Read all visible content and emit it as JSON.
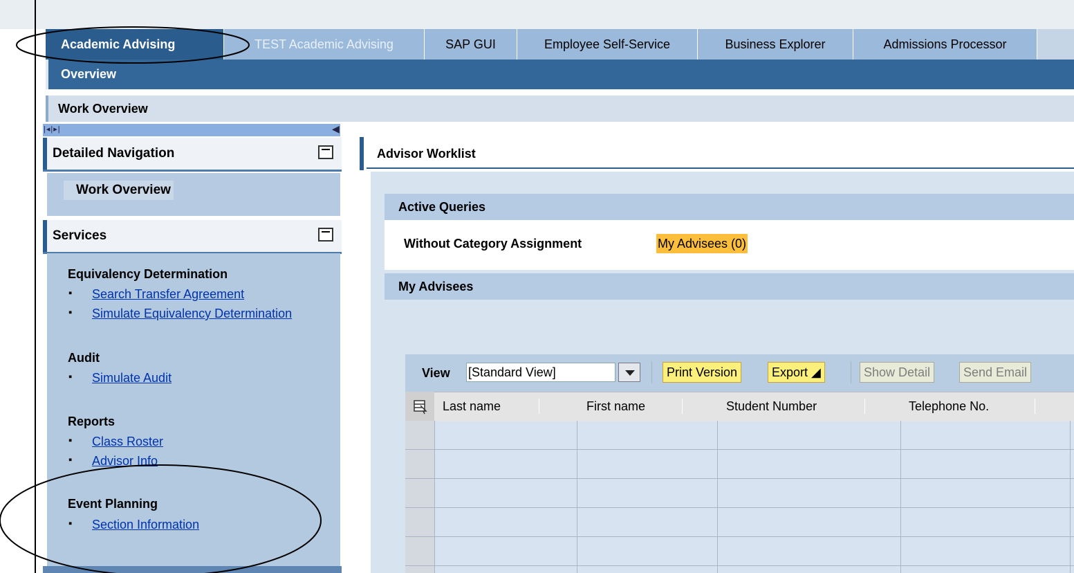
{
  "topnav": {
    "tabs": [
      {
        "label": "Academic Advising"
      },
      {
        "label": "TEST Academic Advising"
      },
      {
        "label": "SAP GUI"
      },
      {
        "label": "Employee Self-Service"
      },
      {
        "label": "Business Explorer"
      },
      {
        "label": "Admissions Processor"
      }
    ],
    "subtab": "Overview"
  },
  "page_title": "Work Overview",
  "detailed_navigation": {
    "title": "Detailed Navigation",
    "item": "Work Overview"
  },
  "services": {
    "title": "Services",
    "groups": [
      {
        "title": "Equivalency Determination",
        "links": [
          "Search Transfer Agreement",
          "Simulate Equivalency Determination"
        ]
      },
      {
        "title": "Audit",
        "links": [
          "Simulate Audit"
        ]
      },
      {
        "title": "Reports",
        "links": [
          "Class Roster",
          "Advisor Info"
        ]
      },
      {
        "title": "Event Planning",
        "links": [
          "Section Information"
        ]
      }
    ]
  },
  "worklist": {
    "title": "Advisor Worklist",
    "active_queries": {
      "title": "Active Queries",
      "label": "Without Category Assignment",
      "query_link": "My Advisees (0)"
    },
    "my_advisees": {
      "title": "My Advisees",
      "view_label": "View",
      "view_value": "[Standard View]",
      "buttons": [
        "Print Version",
        "Export ◢",
        "Show Detail",
        "Send Email"
      ],
      "columns": [
        "Last name",
        "First name",
        "Student Number",
        "Telephone No."
      ],
      "row_count": 5
    }
  }
}
